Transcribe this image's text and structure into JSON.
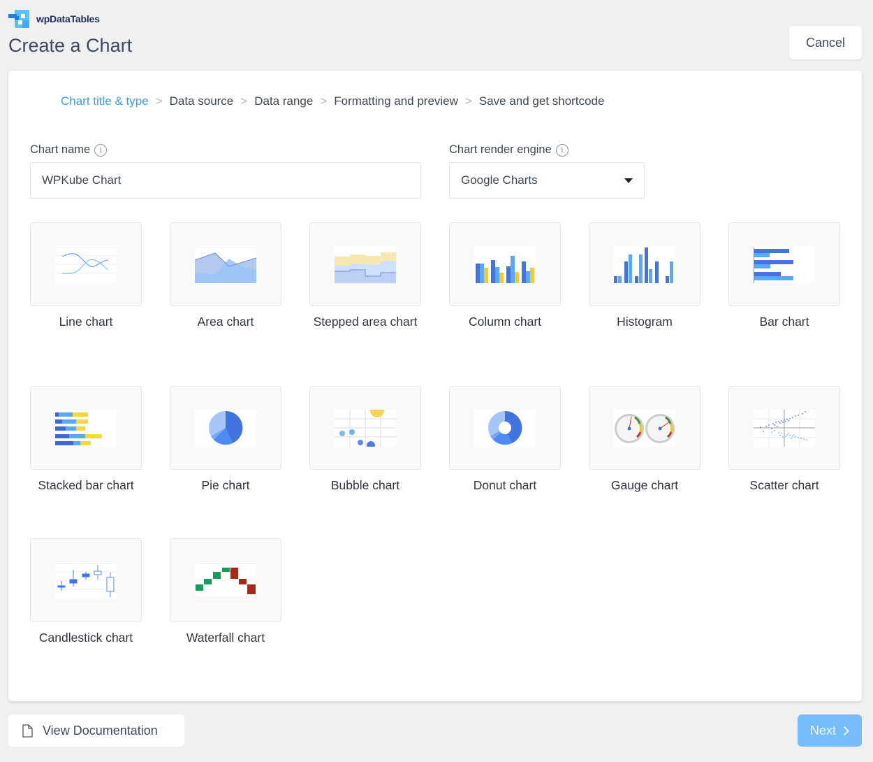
{
  "brand": {
    "name": "wpDataTables",
    "logo_icon": "wpdatatables-logo-icon"
  },
  "page": {
    "title": "Create a Chart"
  },
  "header": {
    "cancel_label": "Cancel"
  },
  "wizard": {
    "steps": [
      {
        "label": "Chart title & type",
        "active": true
      },
      {
        "label": "Data source",
        "active": false
      },
      {
        "label": "Data range",
        "active": false
      },
      {
        "label": "Formatting and preview",
        "active": false
      },
      {
        "label": "Save and get shortcode",
        "active": false
      }
    ],
    "separator": ">"
  },
  "form": {
    "chart_name": {
      "label": "Chart name",
      "value": "WPKube Chart",
      "info_icon": "info-icon"
    },
    "render_engine": {
      "label": "Chart render engine",
      "selected": "Google Charts",
      "info_icon": "info-icon"
    }
  },
  "chart_types": [
    {
      "id": "line",
      "label": "Line chart"
    },
    {
      "id": "area",
      "label": "Area chart"
    },
    {
      "id": "stepped",
      "label": "Stepped area chart"
    },
    {
      "id": "column",
      "label": "Column chart"
    },
    {
      "id": "histogram",
      "label": "Histogram"
    },
    {
      "id": "bar",
      "label": "Bar chart"
    },
    {
      "id": "stacked",
      "label": "Stacked bar chart"
    },
    {
      "id": "pie",
      "label": "Pie chart"
    },
    {
      "id": "bubble",
      "label": "Bubble chart"
    },
    {
      "id": "donut",
      "label": "Donut chart"
    },
    {
      "id": "gauge",
      "label": "Gauge chart"
    },
    {
      "id": "scatter",
      "label": "Scatter chart"
    },
    {
      "id": "candlestick",
      "label": "Candlestick chart"
    },
    {
      "id": "waterfall",
      "label": "Waterfall chart"
    }
  ],
  "footer": {
    "doc_label": "View Documentation",
    "doc_icon": "document-icon",
    "next_label": "Next",
    "next_icon": "chevron-right-icon"
  },
  "colors": {
    "accent": "#3d9cf0",
    "next_button": "#76bdfd",
    "chart_blue_dark": "#4274e0",
    "chart_blue_light": "#58a9f7",
    "chart_yellow": "#f0c93a",
    "waterfall_up": "#139e5b",
    "waterfall_down": "#a52a1a"
  }
}
